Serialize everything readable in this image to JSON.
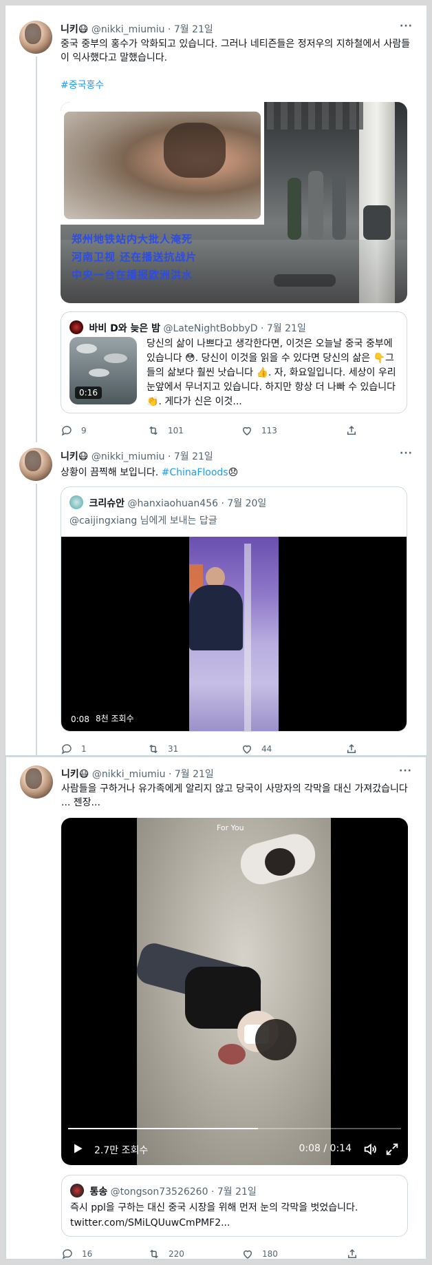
{
  "tweets": [
    {
      "name": "니키😷",
      "handle": "@nikki_miumiu",
      "date": "7월 21일",
      "more": "···",
      "text": "중국 중부의 홍수가 악화되고 있습니다. 그러나 네티즌들은 정저우의 지하철에서 사람들이 익사했다고 말했습니다.",
      "hashtag": "#중국홍수",
      "image_caption": [
        "郑州地铁站内大批人淹死",
        "河南卫视 还在播送抗战片",
        "中央一台在播报欧洲洪水"
      ],
      "quote": {
        "name": "바비 D와 늦은 밤",
        "handle": "@LateNightBobbyD",
        "date": "7월 21일",
        "text": "당신의 삶이 나쁘다고 생각한다면, 이것은 오늘날 중국 중부에 있습니다 😳. 당신이 이것을 읽을 수 있다면 당신의 삶은 👇그들의 삶보다 훨씬 낫습니다 👍. 자, 화요일입니다. 세상이 우리 눈앞에서 무너지고 있습니다. 하지만 항상 더 나빠 수 있습니다 👏. 게다가 신은 이것...",
        "video_time": "0:16"
      },
      "replies": "9",
      "retweets": "101",
      "likes": "113"
    },
    {
      "name": "니키😷",
      "handle": "@nikki_miumiu",
      "date": "7월 21일",
      "more": "···",
      "text": "상황이 끔찍해 보입니다.",
      "hashtag": "#ChinaFloods",
      "emoji": "😞",
      "quote": {
        "name": "크리슈안",
        "handle": "@hanxiaohuan456",
        "date": "7월 20일",
        "reply_to": "@caijingxiang 님에게 보내는 답글",
        "video_time": "0:08",
        "video_views": "8천 조회수"
      },
      "replies": "1",
      "retweets": "31",
      "likes": "44"
    },
    {
      "name": "니키😷",
      "handle": "@nikki_miumiu",
      "date": "7월 21일",
      "more": "···",
      "text": "사람들을 구하거나 유가족에게 알리지 않고 당국이 사망자의 각막을 대신 가져갔습니다 ... 젠장...",
      "video": {
        "overlay": "For You",
        "views": "2.7만 조회수",
        "time": "0:08 / 0:14",
        "progress": 0.57
      },
      "quote": {
        "name": "통송",
        "handle": "@tongson73526260",
        "date": "7월 21일",
        "text": "즉시 ppl을 구하는 대신 중국 시장을 위해 먼저 눈의 각막을 벗었습니다. twitter.com/SMiLQUuwCmPMF2..."
      },
      "replies": "16",
      "retweets": "220",
      "likes": "180"
    }
  ]
}
